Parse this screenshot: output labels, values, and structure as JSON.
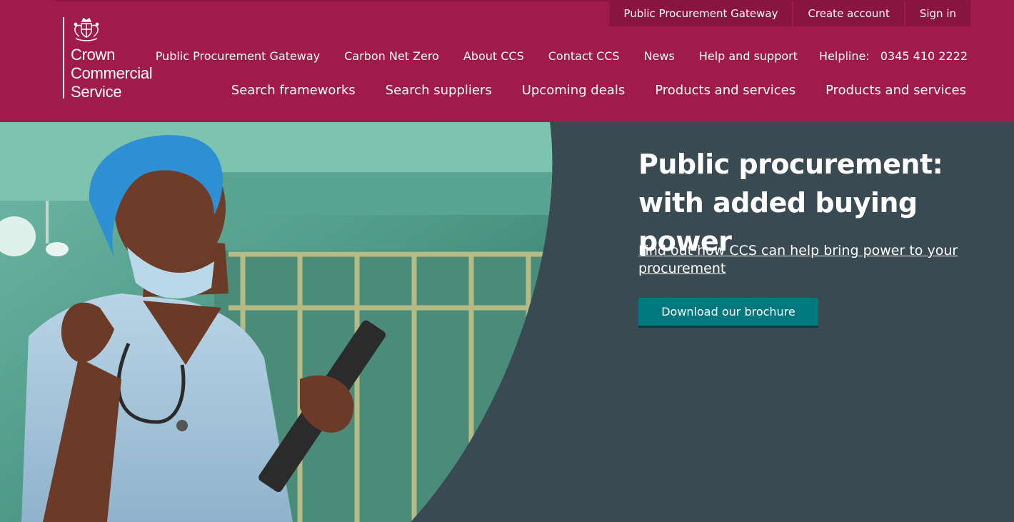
{
  "logo": {
    "lines": [
      "Crown",
      "Commercial",
      "Service"
    ],
    "crest_icon": "royal-crest-icon"
  },
  "topbar": {
    "items": [
      "Public Procurement Gateway",
      "Create account",
      "Sign in"
    ]
  },
  "nav_primary": {
    "links": [
      "Public Procurement Gateway",
      "Carbon Net Zero",
      "About CCS",
      "Contact CCS",
      "News",
      "Help and support"
    ],
    "helpline_label": "Helpline:",
    "helpline_number": "0345 410 2222"
  },
  "nav_secondary": {
    "links": [
      "Search frameworks",
      "Search suppliers",
      "Upcoming deals",
      "Products and services",
      "Products and services"
    ]
  },
  "hero": {
    "title_line1": "Public procurement:",
    "title_line2": "with added buying power",
    "link_text": "Find out how CCS can help bring power to your procurement",
    "button_label": "Download our brochure",
    "image_icon": "nurse-photo"
  },
  "colors": {
    "brand": "#a01a4a",
    "topbar_item_bg": "#8a1440",
    "hero_bg": "#3a4a52",
    "button": "#00797e"
  }
}
